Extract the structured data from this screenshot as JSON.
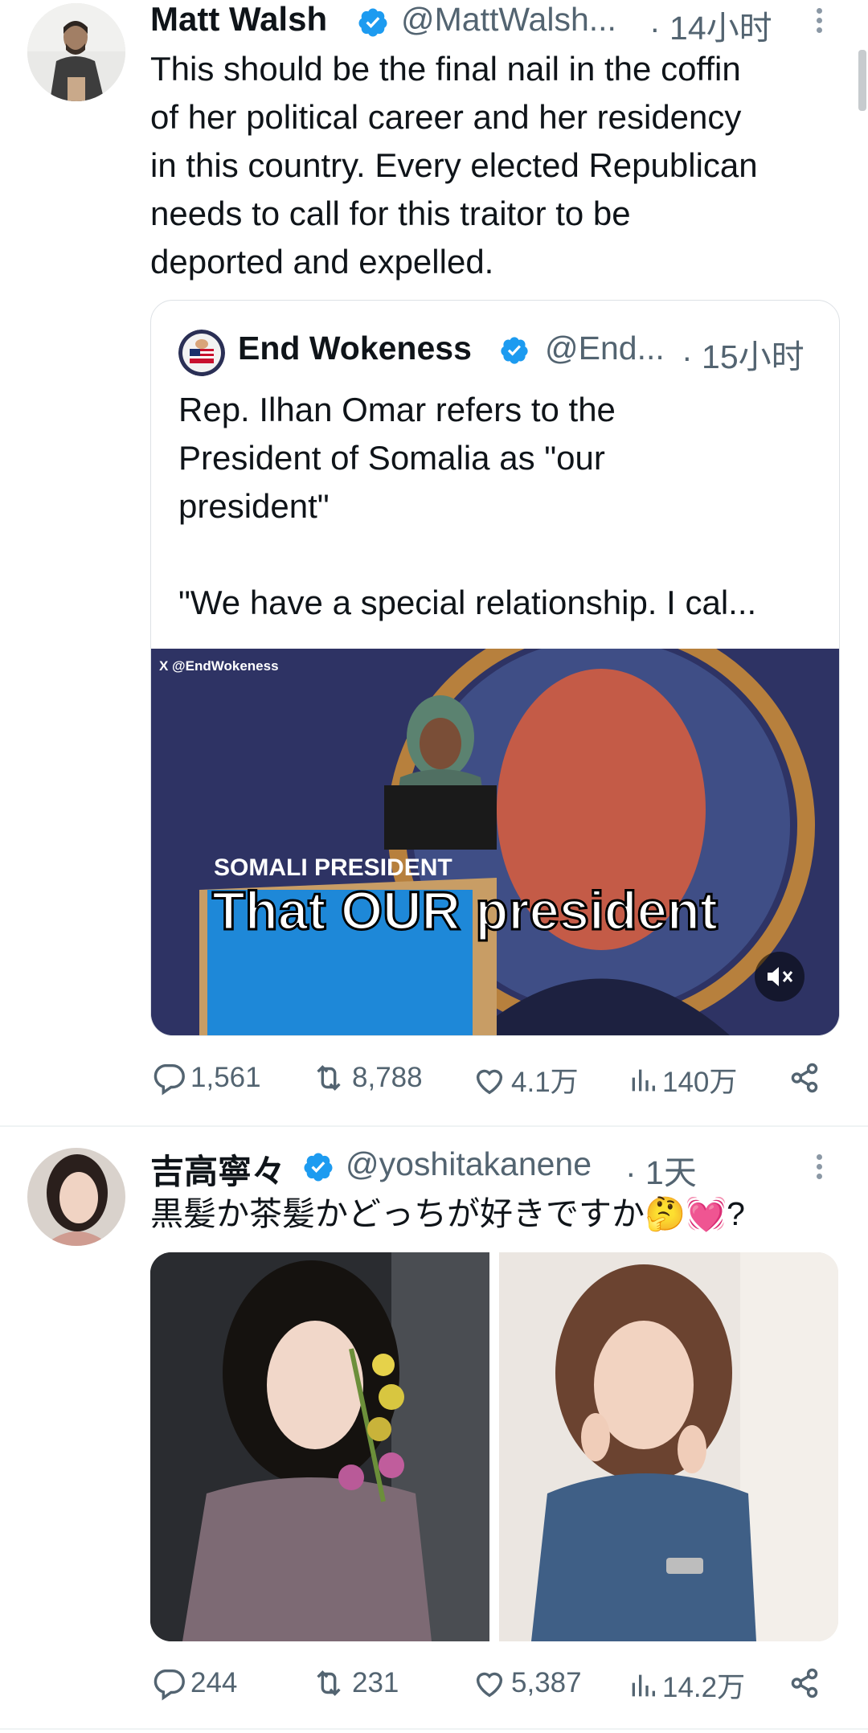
{
  "tweet1": {
    "name": "Matt Walsh",
    "handle": "@MattWalsh...",
    "time": "· 14小时",
    "text_lines": [
      "This should be the final nail in the coffin",
      "of her political career and her residency",
      "in this country. Every elected  Republican",
      "needs to call for this traitor to be",
      "deported and expelled."
    ],
    "quote": {
      "name": "End Wokeness",
      "handle": "@End...",
      "time": "· 15小时",
      "text_lines": [
        "Rep. Ilhan Omar refers to the",
        "President of Somalia as \"our",
        "president\"",
        "",
        "\"We have a special relationship. I cal..."
      ],
      "video": {
        "watermark": "X @EndWokeness",
        "podium_text": "SOMALI PRESIDENT",
        "caption": "That OUR president"
      }
    },
    "stats": {
      "replies": "1,561",
      "reposts": "8,788",
      "likes": "4.1万",
      "views": "140万"
    }
  },
  "tweet2": {
    "name": "吉高寧々",
    "handle": "@yoshitakanene",
    "time": "· 1天",
    "text": "黒髪か茶髪かどっちが好きですか🤔💓?",
    "stats": {
      "replies": "244",
      "reposts": "231",
      "likes": "5,387",
      "views": "14.2万"
    }
  },
  "colors": {
    "verified": "#1d9bf0",
    "text": "#0f1419",
    "secondary": "#536471"
  }
}
